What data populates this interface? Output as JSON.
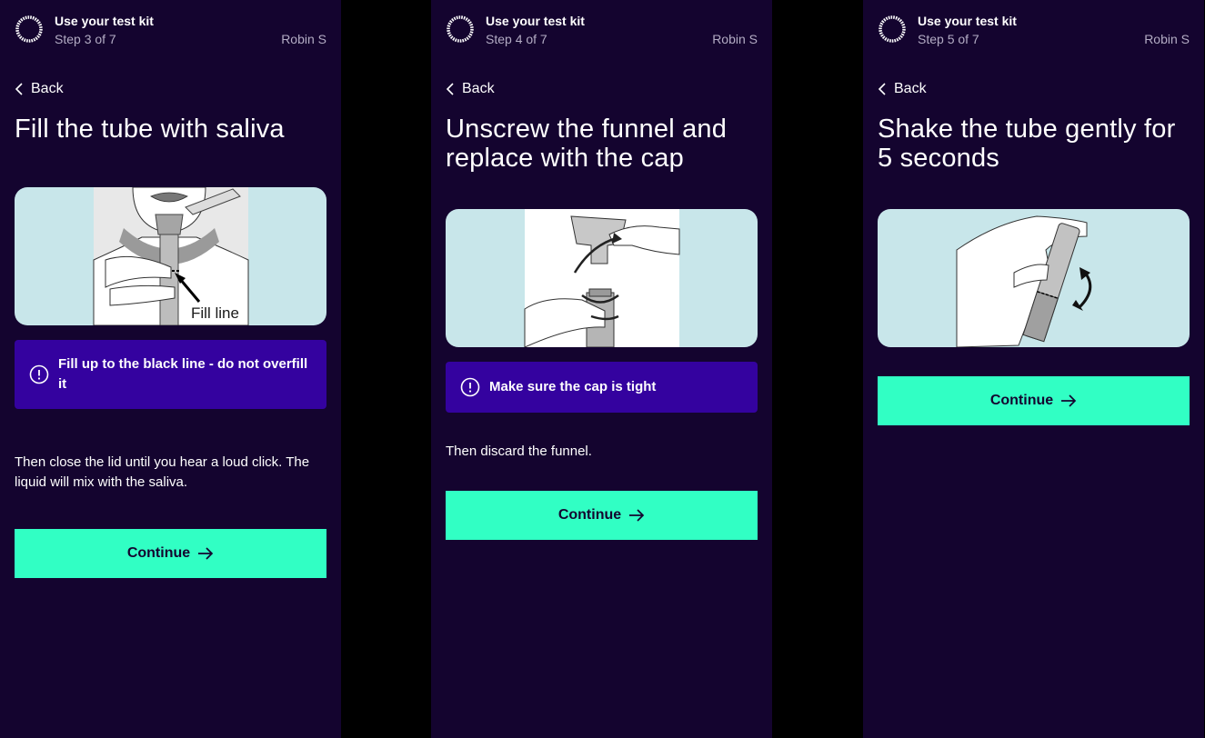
{
  "colors": {
    "background": "#14042f",
    "accent_button": "#31ffc4",
    "alert_bg": "#34029f",
    "illustration_bg": "#c8e6ea"
  },
  "screens": [
    {
      "header": {
        "title": "Use your test kit",
        "step": "Step 3 of 7",
        "user": "Robin S"
      },
      "back_label": "Back",
      "title": "Fill the tube with saliva",
      "illustration_label": "Fill line",
      "alert": "Fill up to the black line - do not overfill it",
      "body": "Then close the lid until you hear a loud click. The liquid will mix with the saliva.",
      "continue_label": "Continue",
      "icons": {
        "back": "chevron-left-icon",
        "alert": "exclamation-circle-icon",
        "continue": "arrow-right-icon"
      }
    },
    {
      "header": {
        "title": "Use your test kit",
        "step": "Step 4 of 7",
        "user": "Robin S"
      },
      "back_label": "Back",
      "title": "Unscrew the funnel and replace with the cap",
      "alert": "Make sure the cap is tight",
      "body": "Then discard the funnel.",
      "continue_label": "Continue"
    },
    {
      "header": {
        "title": "Use your test kit",
        "step": "Step 5 of 7",
        "user": "Robin S"
      },
      "back_label": "Back",
      "title": "Shake the tube gently for 5 seconds",
      "continue_label": "Continue"
    }
  ]
}
